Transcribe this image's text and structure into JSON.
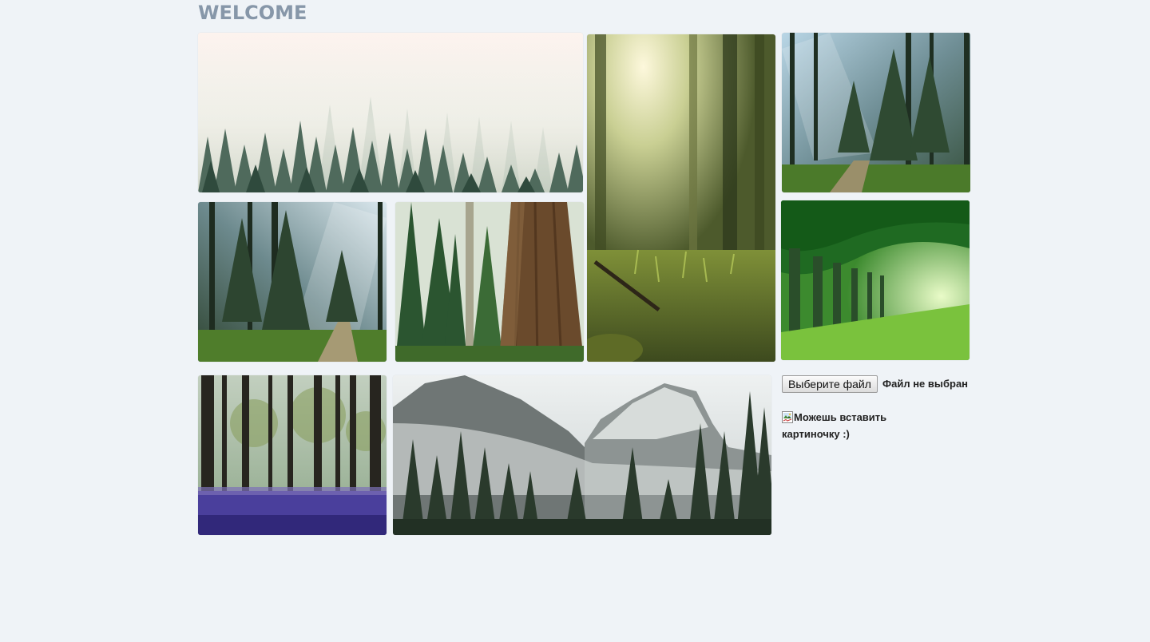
{
  "header": {
    "title": "WELCOME"
  },
  "gallery": {
    "images": [
      {
        "scene": "misty-forest"
      },
      {
        "scene": "sunlit-forest-floor"
      },
      {
        "scene": "forest-path-sunbeams"
      },
      {
        "scene": "forest-trail-light"
      },
      {
        "scene": "giant-sequoia"
      },
      {
        "scene": "green-tree-tunnel"
      },
      {
        "scene": "bluebell-forest"
      },
      {
        "scene": "yosemite-half-dome"
      }
    ]
  },
  "upload": {
    "button_label": "Выберите файл",
    "status_text": "Файл не выбран"
  },
  "preview": {
    "alt_text": "Можешь вставить картиночку :)"
  },
  "colors": {
    "background": "#eff3f7",
    "title": "#8797a9"
  }
}
